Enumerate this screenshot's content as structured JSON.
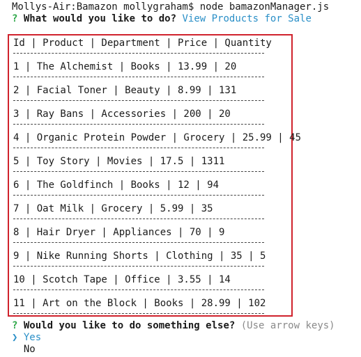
{
  "terminal": {
    "shell_prompt": "Mollys-Air:Bamazon mollygraham$ node bamazonManager.js",
    "question_mark": "?",
    "question_1": "What would you like to do?",
    "answer_1": "View Products for Sale",
    "table": {
      "header": "Id | Product | Department | Price | Quantity",
      "rows": [
        "1 | The Alchemist | Books | 13.99 | 20",
        "2 | Facial Toner | Beauty | 8.99 | 131",
        "3 | Ray Bans | Accessories | 200 | 20",
        "4 | Organic Protein Powder | Grocery | 25.99 | 45",
        "5 | Toy Story | Movies | 17.5 | 1311",
        "6 | The Goldfinch | Books | 12 | 94",
        "7 | Oat Milk | Grocery | 5.99 | 35",
        "8 | Hair Dryer | Appliances | 70 | 9",
        "9 | Nike Running Shorts | Clothing | 35 | 5",
        "10 | Scotch Tape | Office | 3.55 | 14",
        "11 | Art on the Block | Books | 28.99 | 102"
      ]
    },
    "question_2": "Would you like to do something else?",
    "question_2_hint": "(Use arrow keys)",
    "pointer_glyph": "❯",
    "options": [
      "Yes",
      "No"
    ],
    "selected_option": "Yes",
    "highlight_color": "#d0222c"
  }
}
